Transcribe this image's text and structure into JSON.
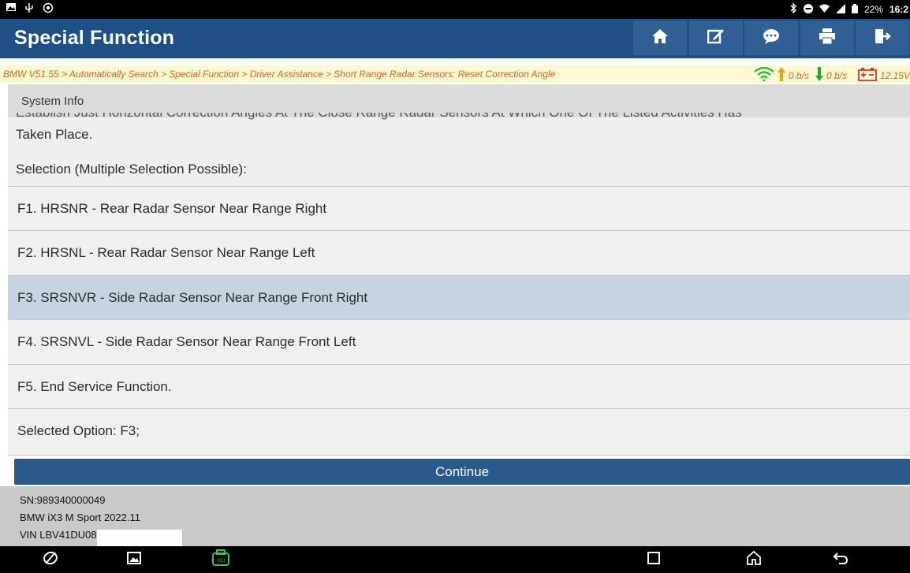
{
  "status_bar": {
    "battery": "22%",
    "time": "16:2"
  },
  "header": {
    "title": "Special Function",
    "toolbar": [
      "home-icon",
      "edit-icon",
      "feedback-icon",
      "print-icon",
      "exit-icon"
    ]
  },
  "breadcrumb": {
    "path": "BMW V51.55 > Automatically Search > Special Function > Driver Assistance > Short Range Radar Sensors: Reset Correction Angle",
    "upload": "0 b/s",
    "download": "0 b/s",
    "voltage": "12.15V"
  },
  "main": {
    "section_label": "System Info",
    "truncated_line": "Establish Just Horizontal Correction Angles At The Close Range Radar Sensors At Which One Of The Listed Activities Has",
    "intro_line": "Taken Place.",
    "selection_hint": "Selection (Multiple Selection Possible):",
    "options": [
      {
        "label": "F1. HRSNR - Rear Radar Sensor Near Range Right"
      },
      {
        "label": "F2. HRSNL - Rear Radar Sensor Near Range Left"
      },
      {
        "label": "F3. SRSNVR - Side Radar Sensor Near Range Front Right"
      },
      {
        "label": "F4. SRSNVL - Side Radar Sensor Near Range Front Left"
      },
      {
        "label": "F5. End Service Function."
      }
    ],
    "selected_index": 2,
    "selected_text": "Selected Option: F3;",
    "continue_label": "Continue"
  },
  "footer": {
    "sn": "SN:989340000049",
    "vehicle": "BMW iX3 M Sport 2022.11",
    "vin": "VIN LBV41DU08RS"
  },
  "colors": {
    "header": "#1e4f86",
    "selected_row": "#c6d4e2",
    "breadcrumb_text": "#e0651a",
    "continue_button": "#285a8c"
  }
}
